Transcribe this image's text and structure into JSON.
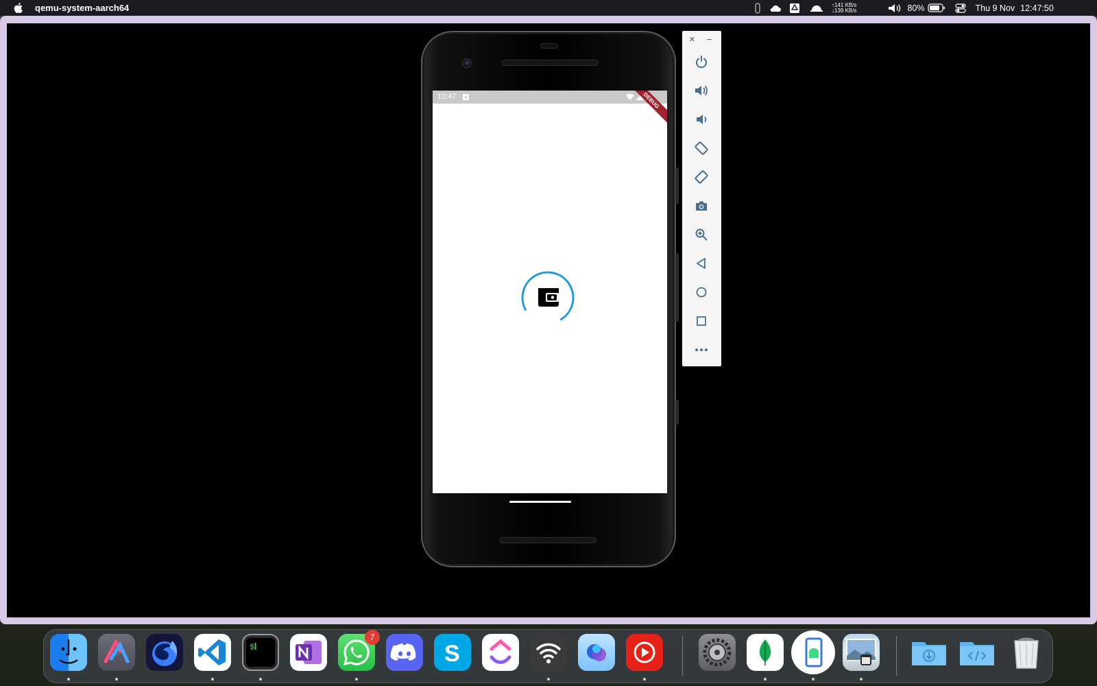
{
  "menubar": {
    "app_name": "qemu-system-aarch64",
    "net_up": "↑141 KB/s",
    "net_down": "↓139 KB/s",
    "battery_percent": "80%",
    "date": "Thu 9 Nov",
    "time": "12:47:50"
  },
  "phone": {
    "status_time": "12:47",
    "debug_banner": "DEBUG",
    "loading_progress_fraction": 0.75
  },
  "emulator_toolbar": {
    "close_label": "×",
    "minimize_label": "–",
    "buttons": [
      "power-icon",
      "volume-up-icon",
      "volume-down-icon",
      "rotate-left-icon",
      "rotate-right-icon",
      "camera-icon",
      "zoom-icon",
      "back-icon",
      "home-icon",
      "overview-icon",
      "more-icon"
    ]
  },
  "dock": {
    "apps": [
      "finder-icon",
      "affinity-designer-icon",
      "firefox-icon",
      "vscode-icon",
      "terminal-icon",
      "onenote-icon",
      "whatsapp-icon",
      "discord-icon",
      "skype-icon",
      "clickup-icon",
      "wifi-app-icon",
      "copilot-icon",
      "youtube-icon",
      "system-settings-icon",
      "mongodb-icon",
      "android-emulator-icon",
      "preview-icon",
      "downloads-folder-icon",
      "code-folder-icon",
      "trash-icon"
    ],
    "whatsapp_badge": "7"
  },
  "colors": {
    "spinner": "#1e9ae0",
    "debug_banner": "#a0222f",
    "toolbar_icon": "#4a6f8c"
  }
}
